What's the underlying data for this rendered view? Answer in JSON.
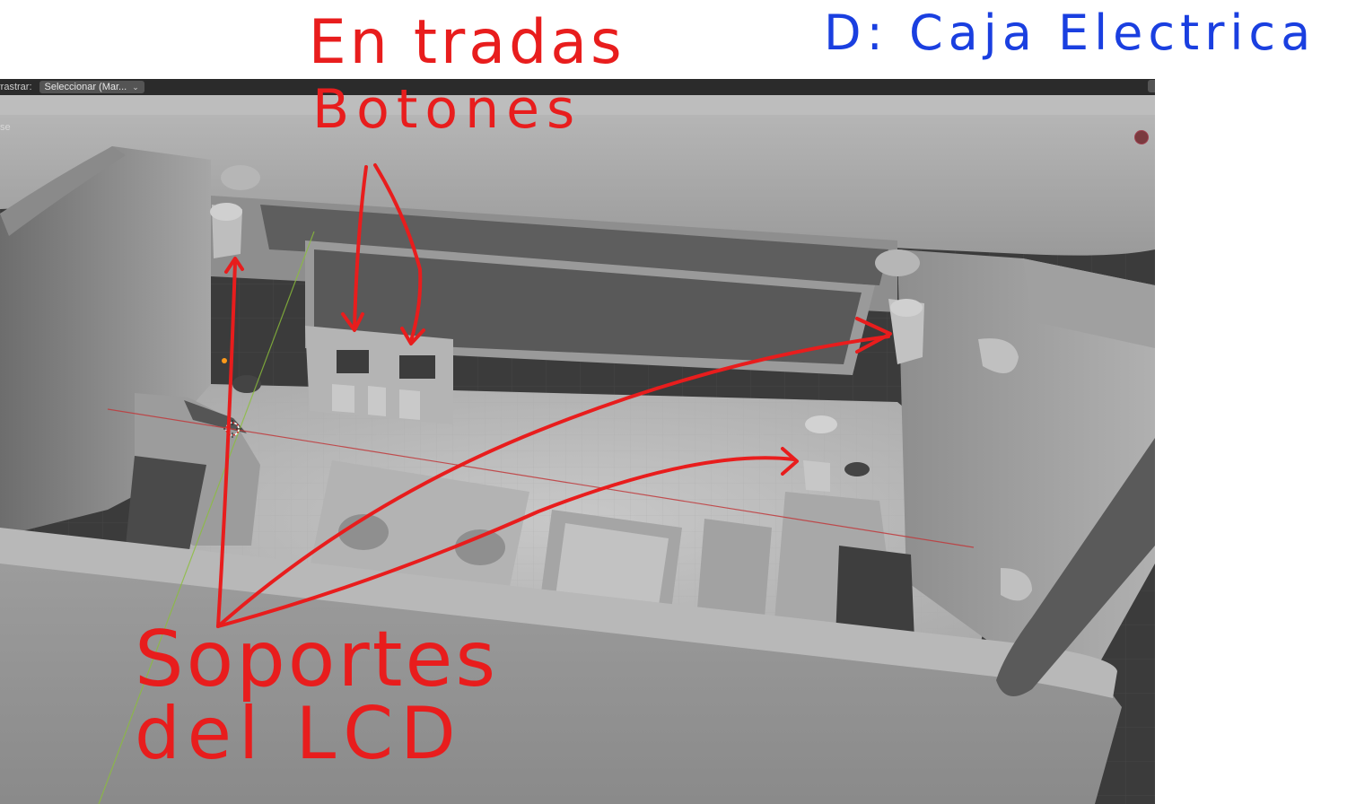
{
  "annotations": {
    "entradas": "En tradas",
    "botones": "Botones",
    "soportes": "Soportes",
    "del_lcd": "del LCD",
    "caja": "D: Caja Electrica"
  },
  "toolbar": {
    "drag_label": "rrastrar:",
    "select_value": "Seleccionar (Mar..."
  },
  "viewport": {
    "mode_label": "se"
  },
  "colors": {
    "annotation_red": "#e81d1d",
    "annotation_blue": "#1a3fe0",
    "viewport_bg": "#3a3a3a",
    "model_gray": "#9b9b9b"
  },
  "icons": [
    "chevron-down-icon",
    "3d-cursor-icon",
    "record-dot-icon"
  ]
}
